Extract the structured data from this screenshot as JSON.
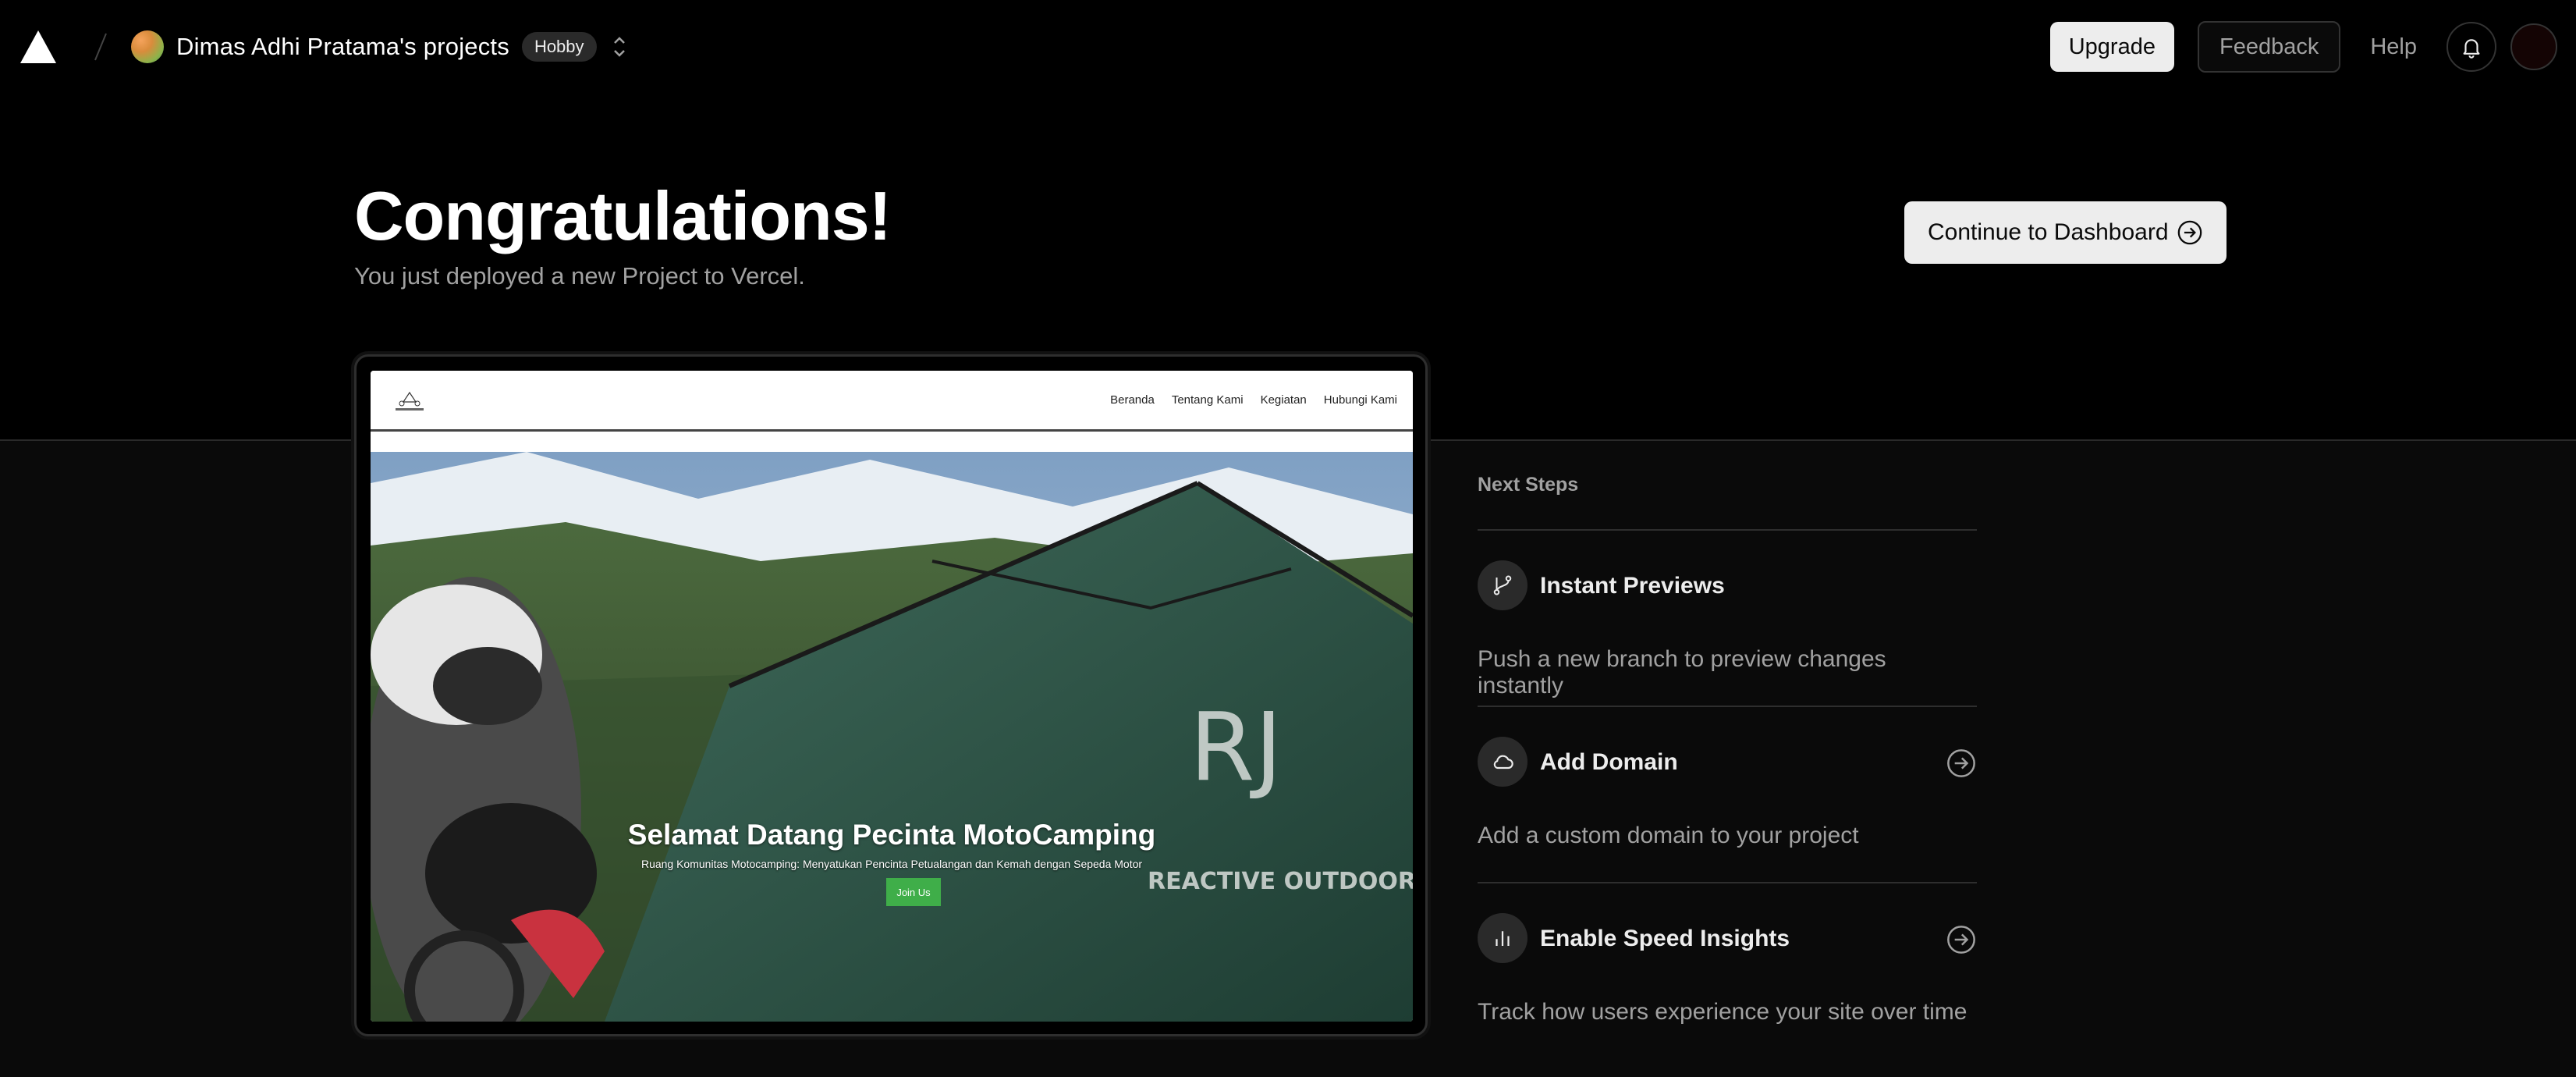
{
  "navbar": {
    "logo_icon": "vercel-triangle-icon",
    "team_name": "Dimas Adhi Pratama's projects",
    "plan_badge": "Hobby",
    "upgrade_label": "Upgrade",
    "feedback_label": "Feedback",
    "help_label": "Help",
    "notifications_icon": "bell-icon"
  },
  "hero": {
    "title": "Congratulations!",
    "subtitle": "You just deployed a new Project to Vercel.",
    "continue_label": "Continue to Dashboard"
  },
  "preview": {
    "nav_items": [
      "Beranda",
      "Tentang Kami",
      "Kegiatan",
      "Hubungi Kami"
    ],
    "hero_title": "Selamat Datang Pecinta MotoCamping",
    "hero_subtitle": "Ruang Komunitas Motocamping: Menyatukan Pencinta Petualangan dan Kemah dengan Sepeda Motor",
    "join_label": "Join Us",
    "tent_brand": "REACTIVE OUTDOOR"
  },
  "next_steps": {
    "heading": "Next Steps",
    "items": [
      {
        "title": "Instant Previews",
        "description": "Push a new branch to preview changes instantly",
        "icon": "git-branch-icon"
      },
      {
        "title": "Add Domain",
        "description": "Add a custom domain to your project",
        "icon": "cloud-icon"
      },
      {
        "title": "Enable Speed Insights",
        "description": "Track how users experience your site over time",
        "icon": "bar-chart-icon"
      }
    ]
  },
  "colors": {
    "background": "#000000",
    "panel": "#0a0a0a",
    "text_primary": "#ededed",
    "text_muted": "#a1a1a1",
    "border": "#2e2e2e",
    "join_button": "#3fae49"
  }
}
